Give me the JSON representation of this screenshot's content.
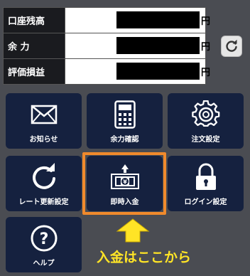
{
  "balance": {
    "rows": [
      {
        "label": "口座残高",
        "unit": "円"
      },
      {
        "label": "余 力",
        "unit": "円"
      },
      {
        "label": "評価損益",
        "unit": "円"
      }
    ]
  },
  "menu": {
    "oshirase": "お知らせ",
    "yoryoku": "余力確認",
    "chumon": "注文設定",
    "rate": "レート更新設定",
    "nyukin": "即時入金",
    "login": "ログイン設定",
    "help": "ヘルプ"
  },
  "callout": "入金はここから",
  "colors": {
    "background": "#4a4c52",
    "tile": "#15213f",
    "highlight": "#f08a2c",
    "callout": "#ffe426"
  }
}
